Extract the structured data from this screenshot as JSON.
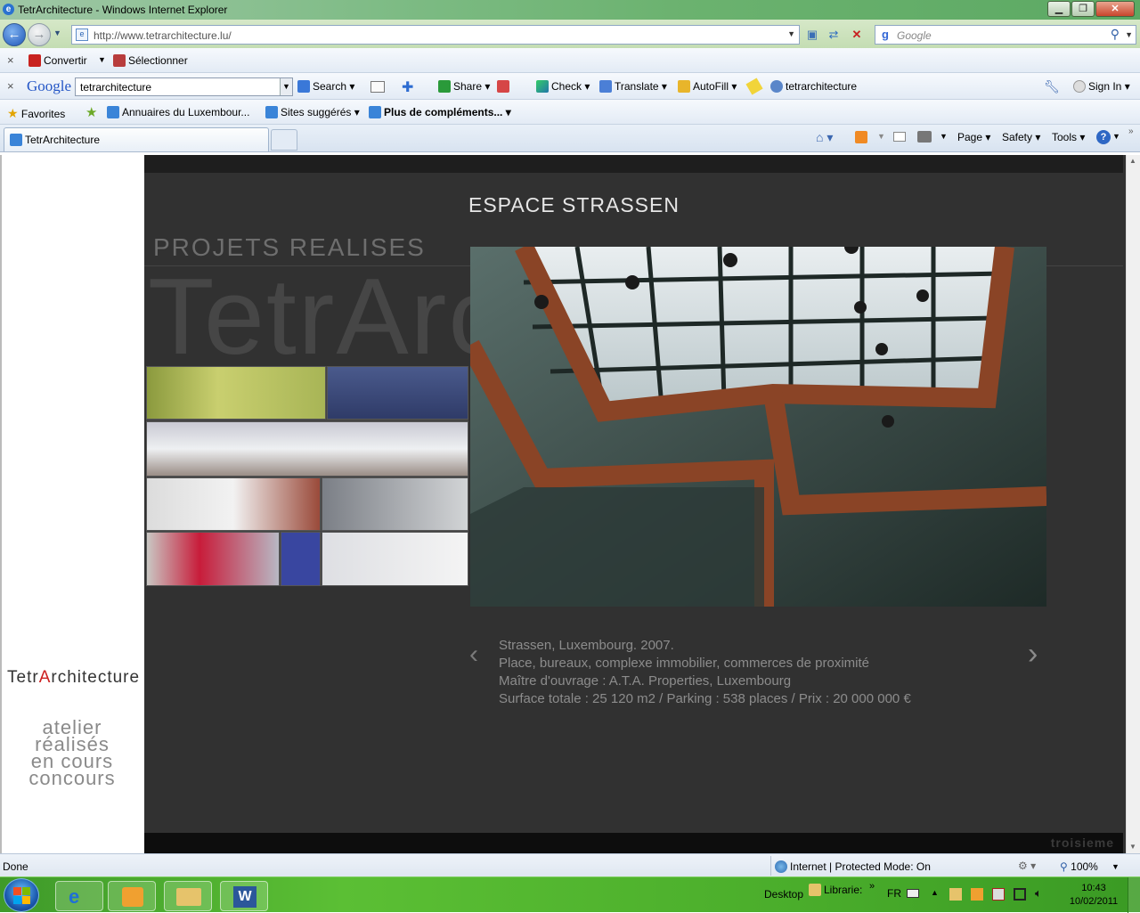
{
  "window": {
    "title": "TetrArchitecture - Windows Internet Explorer",
    "minimize_icon": "minimize-icon",
    "maximize_icon": "maximize-icon",
    "close_icon": "close-icon"
  },
  "address_bar": {
    "url": "http://www.tetrarchitecture.lu/",
    "search_placeholder": "Google"
  },
  "convert_bar": {
    "convert_label": "Convertir",
    "select_label": "Sélectionner"
  },
  "google_toolbar": {
    "logo": "Google",
    "query": "tetrarchitecture",
    "items": [
      "Search",
      "Share",
      "Check",
      "Translate",
      "AutoFill",
      "tetrarchitecture"
    ],
    "sign_in": "Sign In"
  },
  "favorites_bar": {
    "favorites_label": "Favorites",
    "links": [
      "Annuaires du Luxembour...",
      "Sites suggérés",
      "Plus de compléments..."
    ]
  },
  "tabs": {
    "active_tab": "TetrArchitecture"
  },
  "command_bar": {
    "items": [
      "Page",
      "Safety",
      "Tools"
    ]
  },
  "site": {
    "brand_prefix": "Tetr",
    "brand_accent": "A",
    "brand_suffix": "rchitecture",
    "nav": [
      "atelier",
      "réalisés",
      "en cours",
      "concours"
    ],
    "section_title": "PROJETS REALISES",
    "watermark": "TetrArchitecture",
    "project_title": "ESPACE STRASSEN",
    "project_lines": [
      "Strassen, Luxembourg. 2007.",
      "Place, bureaux, complexe immobilier, commerces de proximité",
      "Maître d'ouvrage : A.T.A. Properties, Luxembourg",
      "Surface totale : 25 120 m2 / Parking : 538 places / Prix : 20 000 000 €"
    ],
    "prev_icon": "chevron-left-icon",
    "next_icon": "chevron-right-icon",
    "footer_credit": "troisieme"
  },
  "status_bar": {
    "status": "Done",
    "zone": "Internet | Protected Mode: On",
    "zoom": "100%"
  },
  "taskbar": {
    "desktop_label": "Desktop",
    "libraries_label": "Librarie:",
    "language": "FR",
    "time": "10:43",
    "date": "10/02/2011"
  },
  "colors": {
    "brand_accent": "#cc1f1f",
    "content_bg": "#313131",
    "taskbar_green": "#4aad2b"
  }
}
